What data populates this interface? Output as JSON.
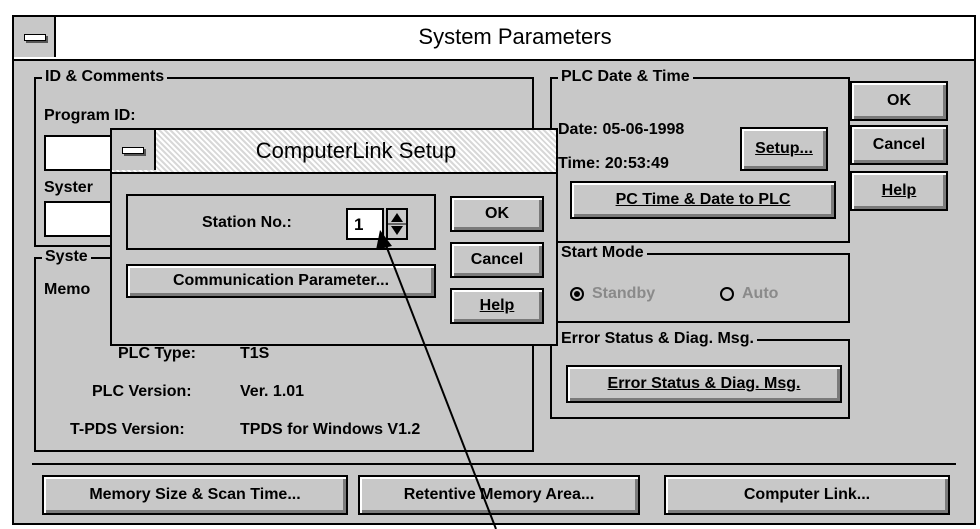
{
  "window": {
    "title": "System Parameters"
  },
  "id_comments": {
    "label": "ID & Comments",
    "program_id_label": "Program ID:",
    "system_label_partial": "Syster"
  },
  "system_info": {
    "label_partial": "Syste",
    "memory_partial": "Memo",
    "hidden_partial": "S",
    "plc_type_label": "PLC Type:",
    "plc_type_value": "T1S",
    "plc_version_label": "PLC Version:",
    "plc_version_value": "Ver. 1.01",
    "tpds_version_label": "T-PDS Version:",
    "tpds_version_value": "TPDS for Windows V1.2"
  },
  "plc_date_time": {
    "label": "PLC Date & Time",
    "date_text": "Date: 05-06-1998",
    "time_text": "Time: 20:53:49",
    "setup_button": "Setup...",
    "pc_time_button": "PC Time & Date to PLC"
  },
  "start_mode": {
    "label": "Start Mode",
    "options": [
      {
        "label": "Standby",
        "selected": true
      },
      {
        "label": "Auto",
        "selected": false
      }
    ]
  },
  "error_status": {
    "label": "Error Status & Diag. Msg.",
    "button": "Error Status & Diag. Msg."
  },
  "main_buttons": {
    "ok": "OK",
    "cancel": "Cancel",
    "help": "Help"
  },
  "bottom_buttons": {
    "memory": "Memory Size & Scan Time...",
    "retentive": "Retentive Memory Area...",
    "computer_link": "Computer Link..."
  },
  "dialog": {
    "title": "ComputerLink Setup",
    "station_label": "Station No.:",
    "station_value": "1",
    "comm_button": "Communication Parameter...",
    "ok": "OK",
    "cancel": "Cancel",
    "help": "Help"
  }
}
